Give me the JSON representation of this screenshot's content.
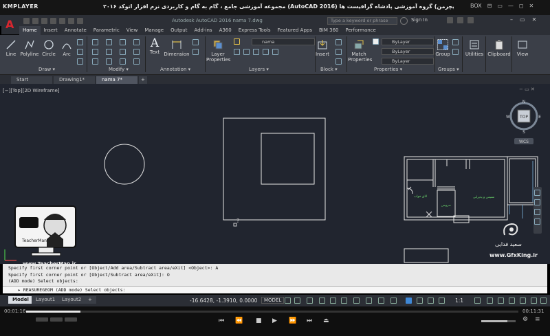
{
  "player": {
    "logo": "KMPLAYER",
    "title": "مجموعه آموزشی جامع ، گام به گام و کاربردی نرم افزار  اتوکد ۲۰۱۶ (AutoCAD 2016)   مدرس : سعید فدایی (تیچرمن) گروه آموزشی پادشاه گرافیست ها",
    "top_controls": [
      "BOX",
      "⊟",
      "▭",
      "—",
      "◻",
      "✕"
    ],
    "current_time": "00:01:16",
    "total_time": "00:11:31",
    "progress": 0.11
  },
  "acad": {
    "app_title": "Autodesk AutoCAD 2016   nama 7.dwg",
    "search_placeholder": "Type a keyword or phrase",
    "sign_in": "Sign In",
    "ribbon_tabs": [
      "Home",
      "Insert",
      "Annotate",
      "Parametric",
      "View",
      "Manage",
      "Output",
      "Add-ins",
      "A360",
      "Express Tools",
      "Featured Apps",
      "BIM 360",
      "Performance"
    ],
    "tools": {
      "line": "Line",
      "polyline": "Polyline",
      "circle": "Circle",
      "arc": "Arc",
      "text": "Text",
      "dimension": "Dimension",
      "layer_properties": "Layer Properties",
      "insert": "Insert",
      "match_properties": "Match Properties",
      "group": "Group",
      "utilities": "Utilities",
      "clipboard": "Clipboard",
      "view": "View"
    },
    "panels": {
      "draw": "Draw ▾",
      "modify": "Modify ▾",
      "annotation": "Annotation ▾",
      "layers": "Layers ▾",
      "block": "Block ▾",
      "properties": "Properties ▾",
      "groups": "Groups ▾"
    },
    "layer_current": "nama",
    "bylayer": [
      "ByLayer",
      "ByLayer",
      "ByLayer"
    ],
    "file_tabs": [
      "Start",
      "Drawing1*",
      "nama 7*",
      "+"
    ],
    "view_label": "[−][Top][2D Wireframe]",
    "viewcube_top": "TOP",
    "compass": [
      "N",
      "W",
      "E",
      "S"
    ],
    "wcs": "WCS",
    "cmd_history": [
      "Specify first corner point or [Object/Add area/Subtract area/eXit] <Object>: A",
      "Specify first corner point or [Object/Subtract area/eXit]: O",
      "(ADD mode) Select objects:"
    ],
    "cmd_current": "▸ REASUREGEOM (ADD mode) Select objects:",
    "layout_tabs": [
      "Model",
      "Layout1",
      "Layout2",
      "+"
    ],
    "coords": "-16.6428, -1.3910, 0.0000",
    "model_btn": "MODEL",
    "scale": "1:1"
  },
  "watermark": {
    "url": "www.TeacherMan.ir",
    "site": "www.GfxKing.ir",
    "name": "سعید فدایی",
    "badge": "TeacherMan"
  },
  "room_labels": [
    "اتاق خواب",
    "نشیمن و پذیرایی",
    "سرویس"
  ]
}
